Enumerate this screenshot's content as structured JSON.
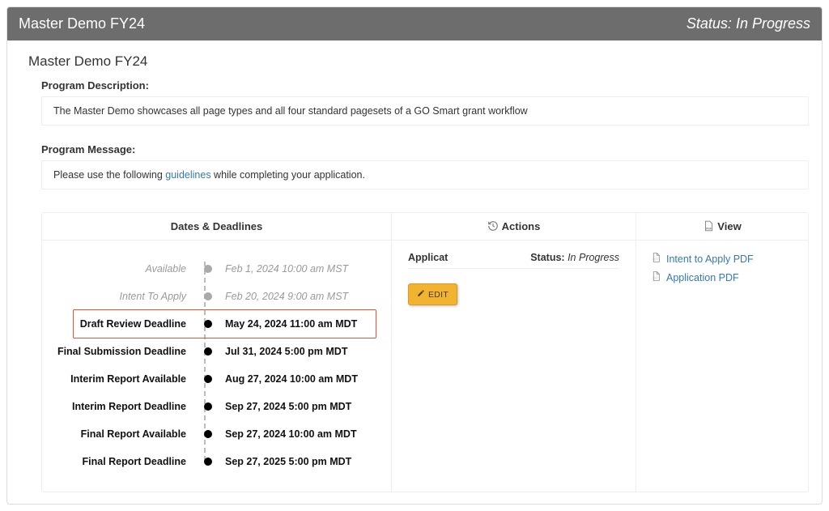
{
  "topbar": {
    "title": "Master Demo FY24",
    "status_label": "Status:",
    "status_value": "In Progress"
  },
  "page": {
    "title": "Master Demo FY24"
  },
  "description": {
    "label": "Program Description:",
    "text": "The Master Demo showcases all page types and all four standard pagesets of a GO Smart grant workflow"
  },
  "message": {
    "label": "Program Message:",
    "prefix": "Please use the following ",
    "link_text": "guidelines",
    "suffix": " while completing your application."
  },
  "columns": {
    "dates": "Dates & Deadlines",
    "actions": "Actions",
    "view": "View"
  },
  "timeline": [
    {
      "label": "Available",
      "date": "Feb 1, 2024 10:00 am MST",
      "state": "past",
      "highlight": false
    },
    {
      "label": "Intent To Apply",
      "date": "Feb 20, 2024 9:00 am MST",
      "state": "past",
      "highlight": false
    },
    {
      "label": "Draft Review Deadline",
      "date": "May 24, 2024 11:00 am MDT",
      "state": "future",
      "highlight": true
    },
    {
      "label": "Final Submission Deadline",
      "date": "Jul 31, 2024 5:00 pm MDT",
      "state": "future",
      "highlight": false
    },
    {
      "label": "Interim Report Available",
      "date": "Aug 27, 2024 10:00 am MDT",
      "state": "future",
      "highlight": false
    },
    {
      "label": "Interim Report Deadline",
      "date": "Sep 27, 2024 5:00 pm MDT",
      "state": "future",
      "highlight": false
    },
    {
      "label": "Final Report Available",
      "date": "Sep 27, 2024 10:00 am MDT",
      "state": "future",
      "highlight": false
    },
    {
      "label": "Final Report Deadline",
      "date": "Sep 27, 2025 5:00 pm MDT",
      "state": "future",
      "highlight": false
    }
  ],
  "actions": {
    "app_label": "Application",
    "status_label": "Status:",
    "status_value": "In Progress",
    "edit_label": "EDIT"
  },
  "view_links": [
    {
      "label": "Intent to Apply PDF"
    },
    {
      "label": "Application PDF"
    }
  ]
}
